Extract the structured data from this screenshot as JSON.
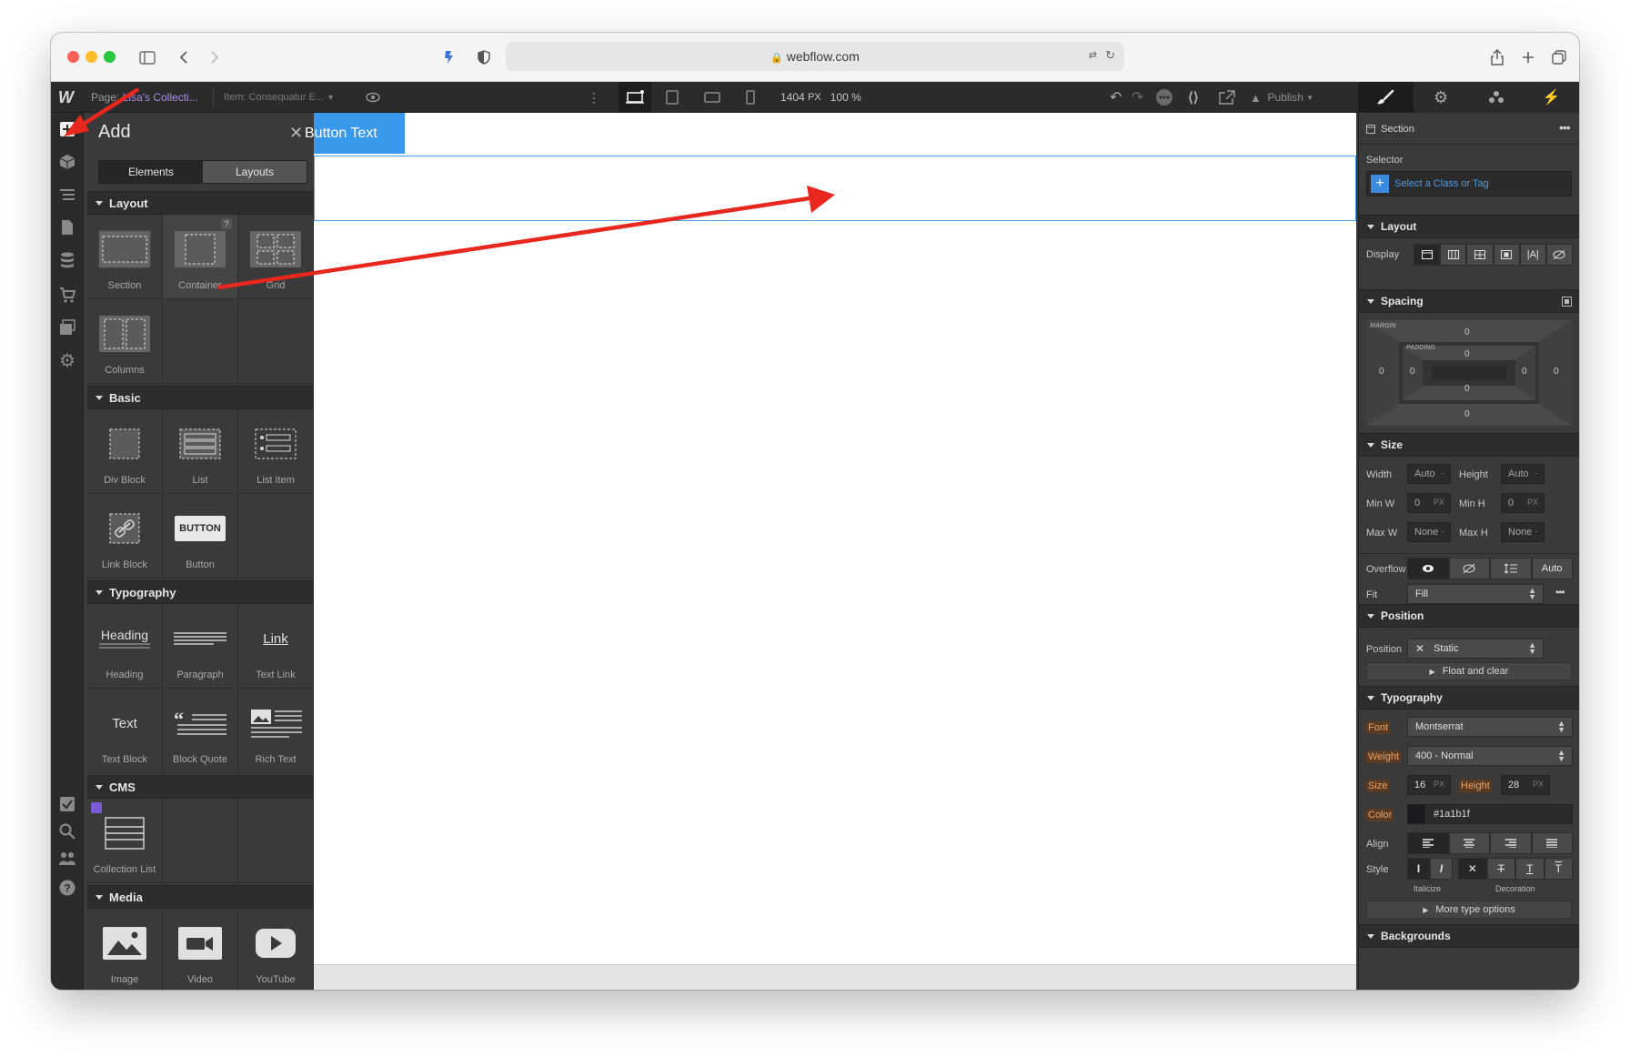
{
  "browser": {
    "url": "webflow.com"
  },
  "topbar": {
    "logo": "W",
    "page_label": "Page:",
    "page_name": "Lisa's Collecti...",
    "item_label": "Item:",
    "item_name": "Consequatur E...",
    "width_value": "1404",
    "width_unit": "PX",
    "zoom": "100 %",
    "publish_label": "Publish"
  },
  "add_panel": {
    "title": "Add",
    "tabs": [
      "Elements",
      "Layouts"
    ],
    "categories": {
      "layout": {
        "title": "Layout",
        "items": [
          "Section",
          "Container",
          "Grid",
          "Columns"
        ]
      },
      "basic": {
        "title": "Basic",
        "items": [
          "Div Block",
          "List",
          "List Item",
          "Link Block",
          "Button"
        ]
      },
      "typography": {
        "title": "Typography",
        "items": [
          "Heading",
          "Paragraph",
          "Text Link",
          "Text Block",
          "Block Quote",
          "Rich Text"
        ]
      },
      "cms": {
        "title": "CMS",
        "items": [
          "Collection List"
        ]
      },
      "media": {
        "title": "Media",
        "items": [
          "Image",
          "Video",
          "YouTube"
        ]
      }
    },
    "icon_text": {
      "button": "BUTTON",
      "heading": "Heading",
      "link": "Link",
      "text": "Text",
      "container_help": "?"
    }
  },
  "canvas": {
    "button_text": "Button Text"
  },
  "right_panel": {
    "element": "Section",
    "selector_label": "Selector",
    "selector_placeholder": "Select a Class or Tag",
    "layout": {
      "title": "Layout",
      "display_label": "Display"
    },
    "spacing": {
      "title": "Spacing",
      "margin_label": "MARGIN",
      "padding_label": "PADDING",
      "margin_top": "0",
      "margin_left": "0",
      "margin_right": "0",
      "margin_bottom": "0",
      "padding_top": "0",
      "padding_left": "0",
      "padding_right": "0",
      "padding_bottom": "0"
    },
    "size": {
      "title": "Size",
      "width_label": "Width",
      "width_value": "Auto",
      "width_unit": "-",
      "height_label": "Height",
      "height_value": "Auto",
      "height_unit": "-",
      "minw_label": "Min W",
      "minw_value": "0",
      "minw_unit": "PX",
      "minh_label": "Min H",
      "minh_value": "0",
      "minh_unit": "PX",
      "maxw_label": "Max W",
      "maxw_value": "None",
      "maxw_unit": "-",
      "maxh_label": "Max H",
      "maxh_value": "None",
      "maxh_unit": "-",
      "overflow_label": "Overflow",
      "overflow_auto": "Auto",
      "fit_label": "Fit",
      "fit_value": "Fill"
    },
    "position": {
      "title": "Position",
      "label": "Position",
      "value": "Static",
      "float_clear": "Float and clear"
    },
    "typography": {
      "title": "Typography",
      "font_label": "Font",
      "font_value": "Montserrat",
      "weight_label": "Weight",
      "weight_value": "400 - Normal",
      "size_label": "Size",
      "size_value": "16",
      "size_unit": "PX",
      "height_label": "Height",
      "height_value": "28",
      "height_unit": "PX",
      "color_label": "Color",
      "color_value": "#1a1b1f",
      "align_label": "Align",
      "style_label": "Style",
      "italicize_label": "Italicize",
      "decoration_label": "Decoration",
      "more_options": "More type options"
    },
    "backgrounds": {
      "title": "Backgrounds"
    }
  },
  "colors": {
    "accent": "#3898ec",
    "annotation_arrow": "#e8281e",
    "panel_bg": "#3a3a3a",
    "text_color_swatch": "#1a1b1f"
  }
}
